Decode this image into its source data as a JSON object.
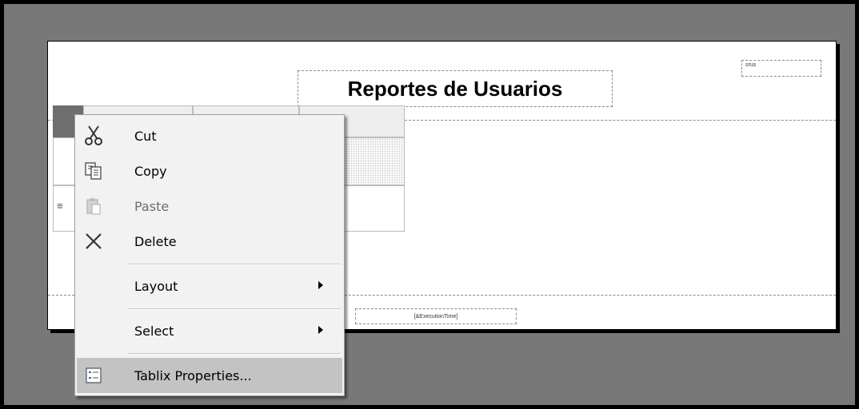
{
  "report": {
    "title": "Reportes de Usuarios",
    "top_right_text": "srus",
    "footer_text": "[&ExecutionTime]",
    "row_handle": "≡"
  },
  "context_menu": {
    "items": [
      {
        "label": "Cut",
        "icon": "scissors-icon",
        "enabled": true
      },
      {
        "label": "Copy",
        "icon": "copy-icon",
        "enabled": true
      },
      {
        "label": "Paste",
        "icon": "paste-icon",
        "enabled": false
      },
      {
        "label": "Delete",
        "icon": "delete-x-icon",
        "enabled": true
      },
      {
        "label": "Layout",
        "submenu": true,
        "enabled": true
      },
      {
        "label": "Select",
        "submenu": true,
        "enabled": true
      },
      {
        "label": "Tablix Properties...",
        "icon": "properties-icon",
        "enabled": true,
        "highlighted": true
      }
    ]
  },
  "colors": {
    "canvas": "#787878",
    "menu_background": "#f2f2f2",
    "menu_highlight": "#c3c3c3"
  }
}
